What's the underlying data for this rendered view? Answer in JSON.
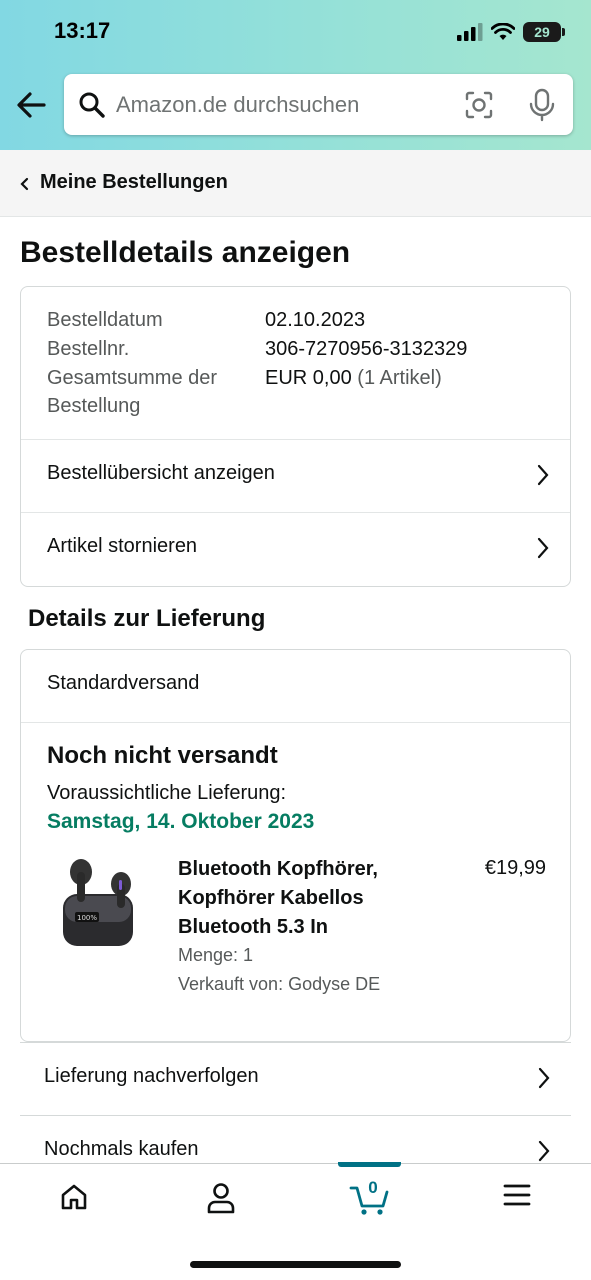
{
  "status_bar": {
    "time": "13:17",
    "battery": "29"
  },
  "search": {
    "placeholder": "Amazon.de durchsuchen"
  },
  "breadcrumb": {
    "label": "Meine Bestellungen"
  },
  "page": {
    "title": "Bestelldetails anzeigen"
  },
  "order_summary": {
    "date_label": "Bestelldatum",
    "date_value": "02.10.2023",
    "number_label": "Bestellnr.",
    "number_value": "306-7270956-3132329",
    "total_label_line1": "Gesamtsumme der",
    "total_label_line2": "Bestellung",
    "total_value": "EUR 0,00",
    "total_items": "(1 Artikel)",
    "links": [
      {
        "label": "Bestellübersicht anzeigen"
      },
      {
        "label": "Artikel stornieren"
      }
    ]
  },
  "delivery": {
    "section_title": "Details zur Lieferung",
    "method": "Standardversand",
    "status": "Noch nicht versandt",
    "estimate_label": "Voraussichtliche Lieferung:",
    "estimate_date": "Samstag, 14. Oktober 2023",
    "estimate_color": "#067d62",
    "product": {
      "title": "Bluetooth Kopfhörer, Kopfhörer Kabellos Bluetooth 5.3 In",
      "price": "€19,99",
      "quantity": "Menge: 1",
      "seller": "Verkauft von: Godyse DE",
      "image_icon": "earbuds-product-image"
    }
  },
  "actions": [
    {
      "label": "Lieferung nachverfolgen"
    },
    {
      "label": "Nochmals kaufen"
    }
  ],
  "bottom_nav": {
    "items": [
      "home-icon",
      "account-icon",
      "cart-icon",
      "menu-icon"
    ],
    "cart_count": "0",
    "accent": "#007185"
  }
}
